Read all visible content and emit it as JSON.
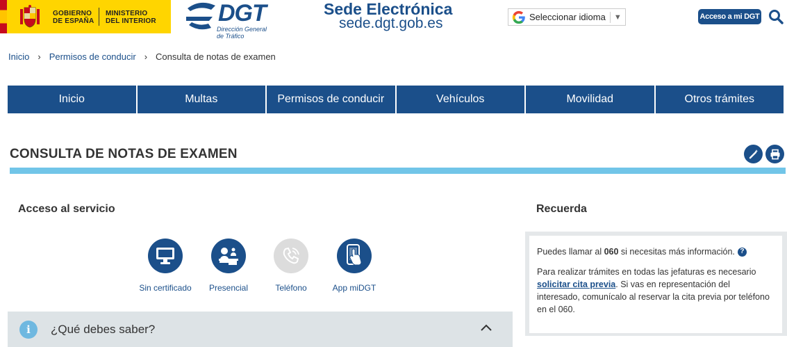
{
  "header": {
    "gov_line1": "GOBIERNO",
    "gov_line2": "DE ESPAÑA",
    "ministry_line1": "MINISTERIO",
    "ministry_line2": "DEL INTERIOR",
    "dgt_word": "DGT",
    "dgt_sub1": "Dirección General",
    "dgt_sub2": "de Tráfico",
    "sede_title": "Sede Electrónica",
    "sede_url": "sede.dgt.gob.es",
    "language_select": "Seleccionar idioma",
    "access_button": "Acceso a mi DGT",
    "search_icon": "search-icon"
  },
  "breadcrumb": {
    "items": [
      "Inicio",
      "Permisos de conducir"
    ],
    "current": "Consulta de notas de examen"
  },
  "nav": {
    "items": [
      "Inicio",
      "Multas",
      "Permisos de conducir",
      "Vehículos",
      "Movilidad",
      "Otros trámites"
    ]
  },
  "page": {
    "title": "CONSULTA DE NOTAS DE EXAMEN",
    "edit_icon": "magic-wand-icon",
    "print_icon": "print-icon"
  },
  "access": {
    "title": "Acceso al servicio",
    "channels": [
      {
        "label": "Sin certificado",
        "icon": "monitor-icon",
        "enabled": true
      },
      {
        "label": "Presencial",
        "icon": "office-desk-icon",
        "enabled": true
      },
      {
        "label": "Teléfono",
        "icon": "phone-icon",
        "enabled": false
      },
      {
        "label": "App miDGT",
        "icon": "smartphone-tap-icon",
        "enabled": true
      }
    ]
  },
  "accordion": {
    "label": "¿Qué debes saber?"
  },
  "recuerda": {
    "title": "Recuerda",
    "p1_before": "Puedes llamar al ",
    "p1_number": "060",
    "p1_after": " si necesitas más información.",
    "p2_before": "Para realizar trámites en todas las jefaturas es necesario ",
    "p2_link": "solicitar cita previa",
    "p2_after": ". Si vas en representación del interesado, comunícalo al reservar la cita previa por teléfono en el 060."
  },
  "colors": {
    "primary": "#1b4f8a",
    "accent_bar": "#71c5e8",
    "gov_yellow": "#ffd500"
  }
}
